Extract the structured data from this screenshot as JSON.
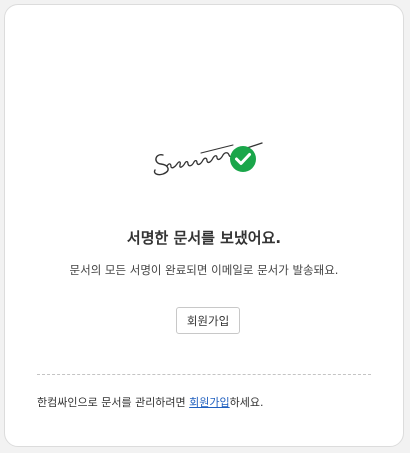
{
  "main": {
    "title": "서명한 문서를 보냈어요.",
    "subtitle": "문서의 모든 서명이 완료되면 이메일로 문서가 발송돼요.",
    "signup_button": "회원가입"
  },
  "footer": {
    "text_before": "한컴싸인으로 문서를 관리하려면 ",
    "link": "회원가입",
    "text_after": "하세요."
  },
  "colors": {
    "check_green": "#1aa64a",
    "link_blue": "#1f5fbf"
  },
  "icons": {
    "illustration": "signature-with-checkmark"
  }
}
